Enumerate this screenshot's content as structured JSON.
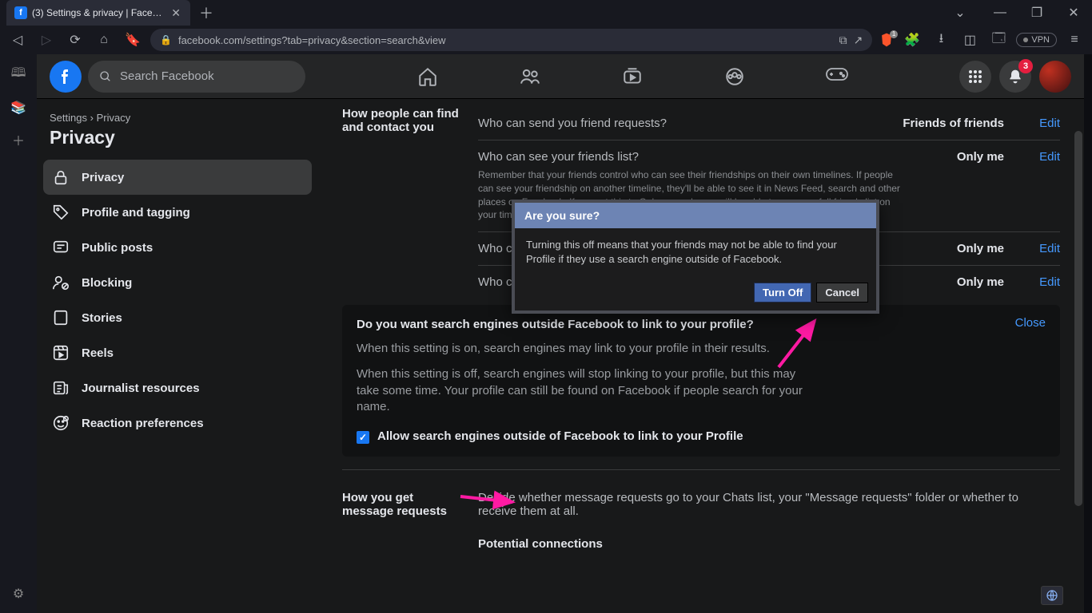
{
  "browser": {
    "tab_title": "(3) Settings & privacy | Facebook",
    "url": "facebook.com/settings?tab=privacy&section=search&view",
    "vpn_label": "VPN",
    "brave_count": "1",
    "notif_count": "3"
  },
  "header": {
    "search_placeholder": "Search Facebook"
  },
  "breadcrumb": {
    "path": "Settings",
    "sep": "›",
    "current": "Privacy"
  },
  "page_title": "Privacy",
  "nav": {
    "items": [
      {
        "label": "Privacy"
      },
      {
        "label": "Profile and tagging"
      },
      {
        "label": "Public posts"
      },
      {
        "label": "Blocking"
      },
      {
        "label": "Stories"
      },
      {
        "label": "Reels"
      },
      {
        "label": "Journalist resources"
      },
      {
        "label": "Reaction preferences"
      }
    ]
  },
  "sections": {
    "contact": {
      "title": "How people can find and contact you",
      "rows": [
        {
          "q": "Who can send you friend requests?",
          "v": "Friends of friends",
          "a": "Edit"
        },
        {
          "q": "Who can see your friends list?",
          "v": "Only me",
          "a": "Edit",
          "sub": "Remember that your friends control who can see their friendships on their own timelines. If people can see your friendship on another timeline, they'll be able to see it in News Feed, search and other places on Facebook. If you set this to Only me, only you will be able to see your full friends list on your timeline. Other people will see only mutual friends."
        },
        {
          "q": "Who can look you up using the email address you provided?",
          "v": "Only me",
          "a": "Edit"
        },
        {
          "q": "Who can look you up using the phone number you provided?",
          "v": "Only me",
          "a": "Edit"
        }
      ]
    },
    "expanded": {
      "title": "Do you want search engines outside Facebook to link to your profile?",
      "p1": "When this setting is on, search engines may link to your profile in their results.",
      "p2": "When this setting is off, search engines will stop linking to your profile, but this may take some time. Your profile can still be found on Facebook if people search for your name.",
      "chk": "Allow search engines outside of Facebook to link to your Profile",
      "close": "Close"
    },
    "messages": {
      "title": "How you get message requests",
      "desc": "Decide whether message requests go to your Chats list, your \"Message requests\" folder or whether to receive them at all.",
      "sub": "Potential connections"
    }
  },
  "dialog": {
    "title": "Are you sure?",
    "body": "Turning this off means that your friends may not be able to find your Profile if they use a search engine outside of Facebook.",
    "primary": "Turn Off",
    "secondary": "Cancel"
  }
}
